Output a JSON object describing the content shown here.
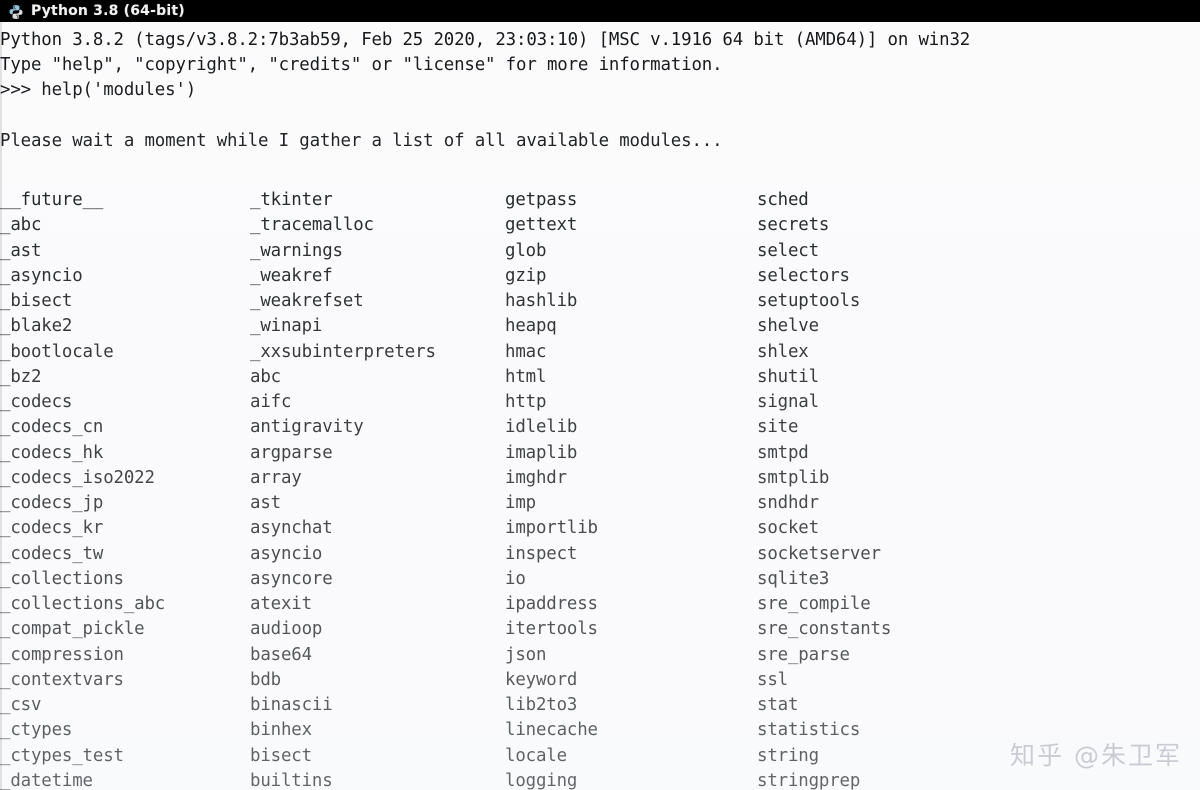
{
  "window": {
    "title": "Python 3.8 (64-bit)",
    "icon": "python-logo-icon",
    "titlebar_color": "#000000",
    "title_text_color": "#f2f2f2",
    "console_background": "#fbfbfc",
    "console_text_color": "#15171b"
  },
  "console": {
    "lines": [
      "Python 3.8.2 (tags/v3.8.2:7b3ab59, Feb 25 2020, 23:03:10) [MSC v.1916 64 bit (AMD64)] on win32",
      "Type \"help\", \"copyright\", \"credits\" or \"license\" for more information.",
      ">>> help('modules')",
      "",
      "Please wait a moment while I gather a list of all available modules..."
    ],
    "prompt": ">>>",
    "command": "help('modules')"
  },
  "modules": {
    "column1": [
      "__future__",
      "_abc",
      "_ast",
      "_asyncio",
      "_bisect",
      "_blake2",
      "_bootlocale",
      "_bz2",
      "_codecs",
      "_codecs_cn",
      "_codecs_hk",
      "_codecs_iso2022",
      "_codecs_jp",
      "_codecs_kr",
      "_codecs_tw",
      "_collections",
      "_collections_abc",
      "_compat_pickle",
      "_compression",
      "_contextvars",
      "_csv",
      "_ctypes",
      "_ctypes_test",
      "_datetime"
    ],
    "column2": [
      "_tkinter",
      "_tracemalloc",
      "_warnings",
      "_weakref",
      "_weakrefset",
      "_winapi",
      "_xxsubinterpreters",
      "abc",
      "aifc",
      "antigravity",
      "argparse",
      "array",
      "ast",
      "asynchat",
      "asyncio",
      "asyncore",
      "atexit",
      "audioop",
      "base64",
      "bdb",
      "binascii",
      "binhex",
      "bisect",
      "builtins"
    ],
    "column3": [
      "getpass",
      "gettext",
      "glob",
      "gzip",
      "hashlib",
      "heapq",
      "hmac",
      "html",
      "http",
      "idlelib",
      "imaplib",
      "imghdr",
      "imp",
      "importlib",
      "inspect",
      "io",
      "ipaddress",
      "itertools",
      "json",
      "keyword",
      "lib2to3",
      "linecache",
      "locale",
      "logging"
    ],
    "column4": [
      "sched",
      "secrets",
      "select",
      "selectors",
      "setuptools",
      "shelve",
      "shlex",
      "shutil",
      "signal",
      "site",
      "smtpd",
      "smtplib",
      "sndhdr",
      "socket",
      "socketserver",
      "sqlite3",
      "sre_compile",
      "sre_constants",
      "sre_parse",
      "ssl",
      "stat",
      "statistics",
      "string",
      "stringprep"
    ]
  },
  "watermark": {
    "text": "知乎 @朱卫军"
  }
}
